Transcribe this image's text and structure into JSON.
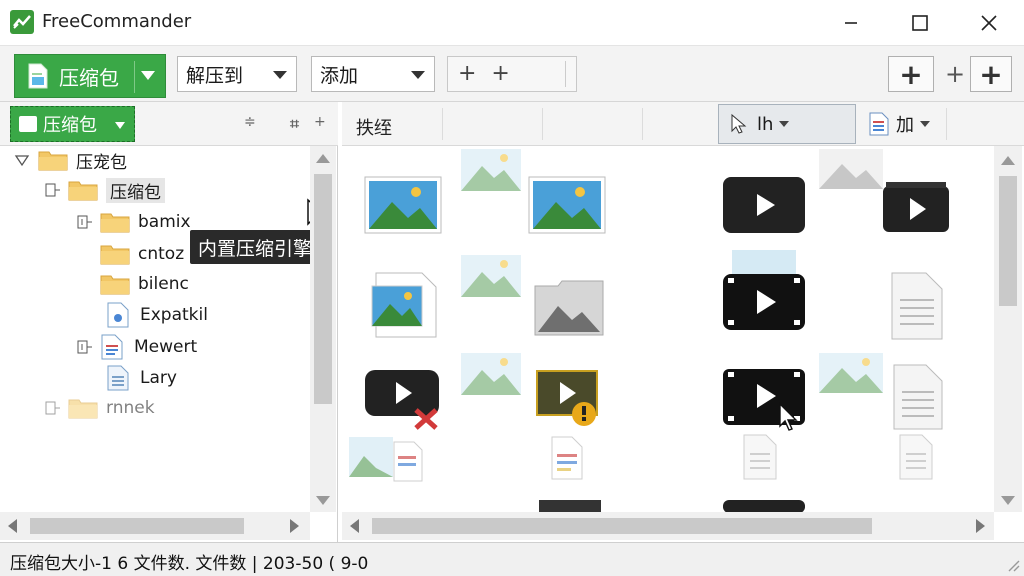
{
  "window": {
    "title": "FreeCommander"
  },
  "toolbar": {
    "pack_label": "压缩包",
    "extract_label": "解压到",
    "add_label": "添加",
    "plus_group_label": "+ +",
    "plus_right_label": "+",
    "plus_far_right_label": "+",
    "mini_plus": "+"
  },
  "left_pane": {
    "combo_label": "压缩包",
    "tooltip": "内置压缩引擎",
    "tree": [
      {
        "label": "压宠包"
      },
      {
        "label": "压缩包"
      },
      {
        "label": "bamix"
      },
      {
        "label": "cntoz"
      },
      {
        "label": "bilenc"
      },
      {
        "label": "Expatkil"
      },
      {
        "label": "Mewert"
      },
      {
        "label": "Lary"
      },
      {
        "label": "rnnek"
      }
    ]
  },
  "right_pane": {
    "col_name": "抶绖",
    "sort_label": "lh",
    "view_label": "加"
  },
  "status": {
    "text": "压缩包大小-1 6  文件数. 文件数 | 203-50 (  9-0"
  },
  "colors": {
    "accent_green": "#3aa847",
    "selection": "#e6e9ec"
  }
}
